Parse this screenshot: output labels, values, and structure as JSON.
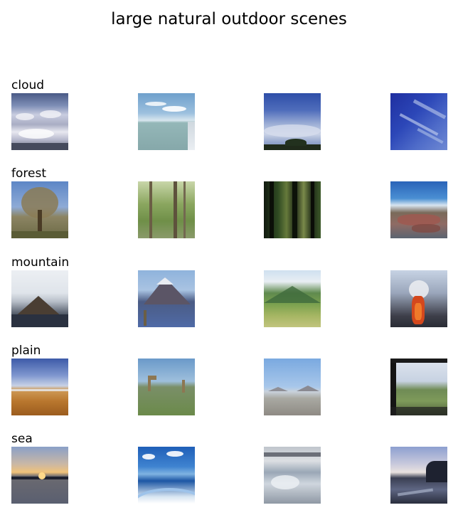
{
  "title": "large natural outdoor scenes",
  "rows": [
    {
      "label": "cloud"
    },
    {
      "label": "forest"
    },
    {
      "label": "mountain"
    },
    {
      "label": "plain"
    },
    {
      "label": "sea"
    }
  ]
}
